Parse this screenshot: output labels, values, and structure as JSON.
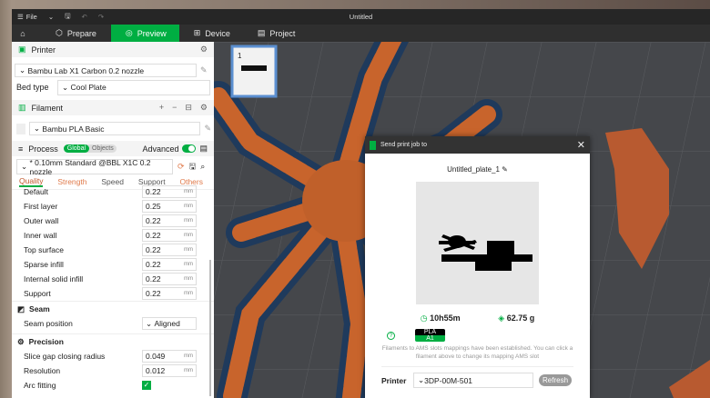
{
  "titlebar": {
    "file": "File",
    "title": "Untitled"
  },
  "tabs": [
    {
      "label": "Prepare"
    },
    {
      "label": "Preview"
    },
    {
      "label": "Device"
    },
    {
      "label": "Project"
    }
  ],
  "printer": {
    "header": "Printer",
    "name": "Bambu Lab X1 Carbon 0.2 nozzle",
    "bed_label": "Bed type",
    "bed": "Cool Plate"
  },
  "filament": {
    "header": "Filament",
    "item": "Bambu PLA Basic"
  },
  "process": {
    "header": "Process",
    "global": "Global",
    "objects": "Objects",
    "advanced": "Advanced",
    "preset": "* 0.10mm Standard @BBL X1C 0.2 nozzle",
    "tabs": [
      "Quality",
      "Strength",
      "Speed",
      "Support",
      "Others"
    ],
    "layer_rows": [
      {
        "label": "Default",
        "value": "0.22"
      },
      {
        "label": "First layer",
        "value": "0.25"
      },
      {
        "label": "Outer wall",
        "value": "0.22"
      },
      {
        "label": "Inner wall",
        "value": "0.22"
      },
      {
        "label": "Top surface",
        "value": "0.22"
      },
      {
        "label": "Sparse infill",
        "value": "0.22"
      },
      {
        "label": "Internal solid infill",
        "value": "0.22"
      },
      {
        "label": "Support",
        "value": "0.22"
      }
    ],
    "unit": "mm",
    "seam": {
      "header": "Seam",
      "label": "Seam position",
      "value": "Aligned"
    },
    "precision": {
      "header": "Precision",
      "rows": [
        {
          "label": "Slice gap closing radius",
          "value": "0.049"
        },
        {
          "label": "Resolution",
          "value": "0.012"
        }
      ],
      "arc_label": "Arc fitting",
      "arc_checked": true
    }
  },
  "plate": {
    "number": "1"
  },
  "dialog": {
    "title": "Send print job to",
    "plate_name": "Untitled_plate_1",
    "time": "10h55m",
    "weight": "62.75 g",
    "filament_type": "PLA",
    "slot": "A1",
    "help": "?",
    "message": "Filaments to AMS slots mappings have been established. You can click a filament above to change its mapping AMS slot",
    "printer_label": "Printer",
    "printer": "3DP-00M-501",
    "refresh": "Refresh"
  },
  "colors": {
    "accent": "#00ae42",
    "model": "#c8642c",
    "support": "#1f3a5c"
  }
}
